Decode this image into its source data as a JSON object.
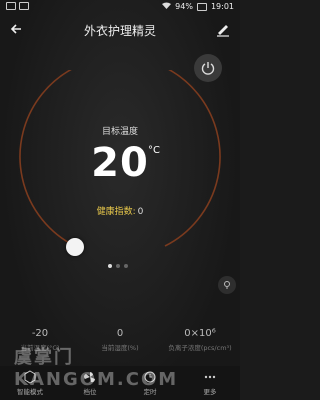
{
  "status": {
    "battery": "94%",
    "time": "19:01"
  },
  "header": {
    "title": "外衣护理精灵"
  },
  "dial": {
    "label": "目标温度",
    "value": "20",
    "unit": "°C",
    "health_label": "健康指数:",
    "health_value": "0"
  },
  "stats": [
    {
      "value": "-20",
      "label": "当前温度(°C)"
    },
    {
      "value": "0",
      "label": "当前湿度(%)"
    },
    {
      "value": "0×10⁶",
      "label": "负离子浓度(pcs/cm³)"
    }
  ],
  "nav": [
    {
      "label": "智能模式",
      "icon": "smart-mode-icon"
    },
    {
      "label": "档位",
      "icon": "fan-icon"
    },
    {
      "label": "定时",
      "icon": "timer-icon"
    },
    {
      "label": "更多",
      "icon": "more-icon"
    }
  ],
  "watermark": "虞掌门 KANGOM.COM",
  "colors": {
    "accent_arc": "#7a3a1e",
    "health": "#e8c84b"
  }
}
